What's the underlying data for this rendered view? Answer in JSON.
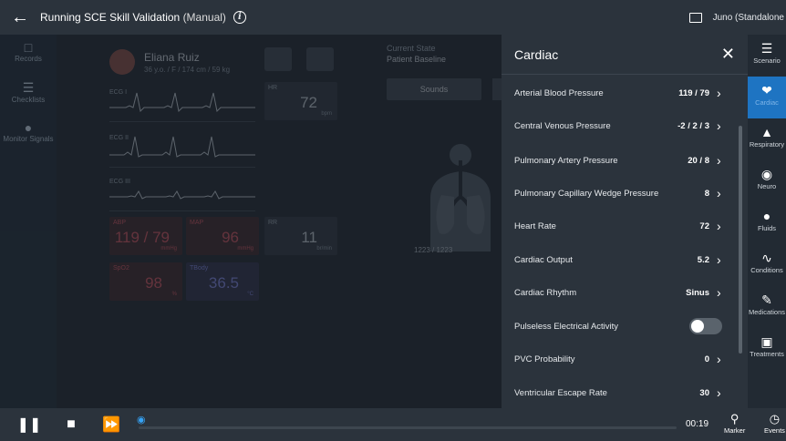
{
  "topbar": {
    "title": "Running SCE",
    "scenario": "Skill Validation",
    "mode": "(Manual)",
    "device": "Juno (Standalone"
  },
  "leftnav": [
    {
      "label": "Records",
      "icon": "clipboard-icon"
    },
    {
      "label": "Checklists",
      "icon": "checklist-icon"
    },
    {
      "label": "Monitor Signals",
      "icon": "monitor-signals-icon"
    }
  ],
  "patient": {
    "name": "Eliana Ruiz",
    "details": "36 y.o. / F / 174 cm / 59 kg"
  },
  "ecg": [
    "ECG I",
    "ECG II",
    "ECG III"
  ],
  "vitals": {
    "hr": {
      "label": "HR",
      "value": "72",
      "unit": "bpm"
    },
    "rr": {
      "label": "RR",
      "value": "11",
      "unit": "br/min"
    },
    "abp": {
      "label": "ABP",
      "value": "119 / 79",
      "unit": "mmHg"
    },
    "map": {
      "label": "MAP",
      "value": "96",
      "unit": "mmHg"
    },
    "spo2": {
      "label": "SpO2",
      "value": "98",
      "unit": "%"
    },
    "tbody": {
      "label": "TBody",
      "value": "36.5",
      "unit": "°C"
    }
  },
  "state": {
    "label": "Current State",
    "value": "Patient Baseline",
    "sounds_label": "Sounds",
    "fraction": "1223 / 1223"
  },
  "panel": {
    "title": "Cardiac",
    "rows": [
      {
        "label": "Arterial Blood Pressure",
        "value": "119 / 79"
      },
      {
        "label": "Central Venous Pressure",
        "value": "-2 / 2 / 3"
      },
      {
        "label": "Pulmonary Artery Pressure",
        "value": "20 / 8"
      },
      {
        "label": "Pulmonary Capillary Wedge Pressure",
        "value": "8"
      },
      {
        "label": "Heart Rate",
        "value": "72"
      },
      {
        "label": "Cardiac Output",
        "value": "5.2"
      },
      {
        "label": "Cardiac Rhythm",
        "value": "Sinus"
      },
      {
        "label": "Pulseless Electrical Activity",
        "value": ""
      },
      {
        "label": "PVC Probability",
        "value": "0"
      },
      {
        "label": "Ventricular Escape Rate",
        "value": "30"
      }
    ]
  },
  "rightnav": [
    {
      "label": "Scenario",
      "icon": "list-icon"
    },
    {
      "label": "Cardiac",
      "icon": "heart-icon"
    },
    {
      "label": "Respiratory",
      "icon": "lungs-icon"
    },
    {
      "label": "Neuro",
      "icon": "brain-icon"
    },
    {
      "label": "Fluids",
      "icon": "drop-icon"
    },
    {
      "label": "Conditions",
      "icon": "pulse-icon"
    },
    {
      "label": "Medications",
      "icon": "pill-icon"
    },
    {
      "label": "Treatments",
      "icon": "treatment-icon"
    }
  ],
  "bottombar": {
    "time": "00:19",
    "marker_label": "Marker",
    "events_label": "Events"
  }
}
